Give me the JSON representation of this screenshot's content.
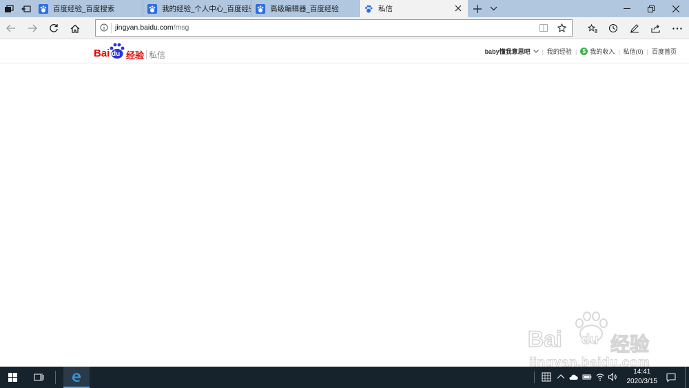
{
  "tabs": [
    {
      "title": "百度经验_百度搜索",
      "active": false
    },
    {
      "title": "我的经验_个人中心_百度经验",
      "active": false
    },
    {
      "title": "高级编辑器_百度经验",
      "active": false
    },
    {
      "title": "私信",
      "active": true
    }
  ],
  "address": {
    "domain": "jingyan.baidu.com",
    "path": "/msg"
  },
  "header": {
    "logo_left": "Bai",
    "logo_mid": "du",
    "logo_right": "经验",
    "section": "私信",
    "username": "baby懂我意思吧",
    "my_experience": "我的经验",
    "my_income": "我的收入",
    "messages": "私信(0)",
    "baidu_home": "百度首页"
  },
  "watermark": {
    "brand": "Bai",
    "brand2": "du",
    "brand3": "经验",
    "url": "jingyan.baidu.com"
  },
  "taskbar": {
    "time": "14:41",
    "date": "2020/3/15"
  },
  "colors": {
    "tabbar": "#b1c7df",
    "baidu_red": "#e10602",
    "baidu_blue": "#2932e1",
    "taskbar": "#16222c"
  }
}
